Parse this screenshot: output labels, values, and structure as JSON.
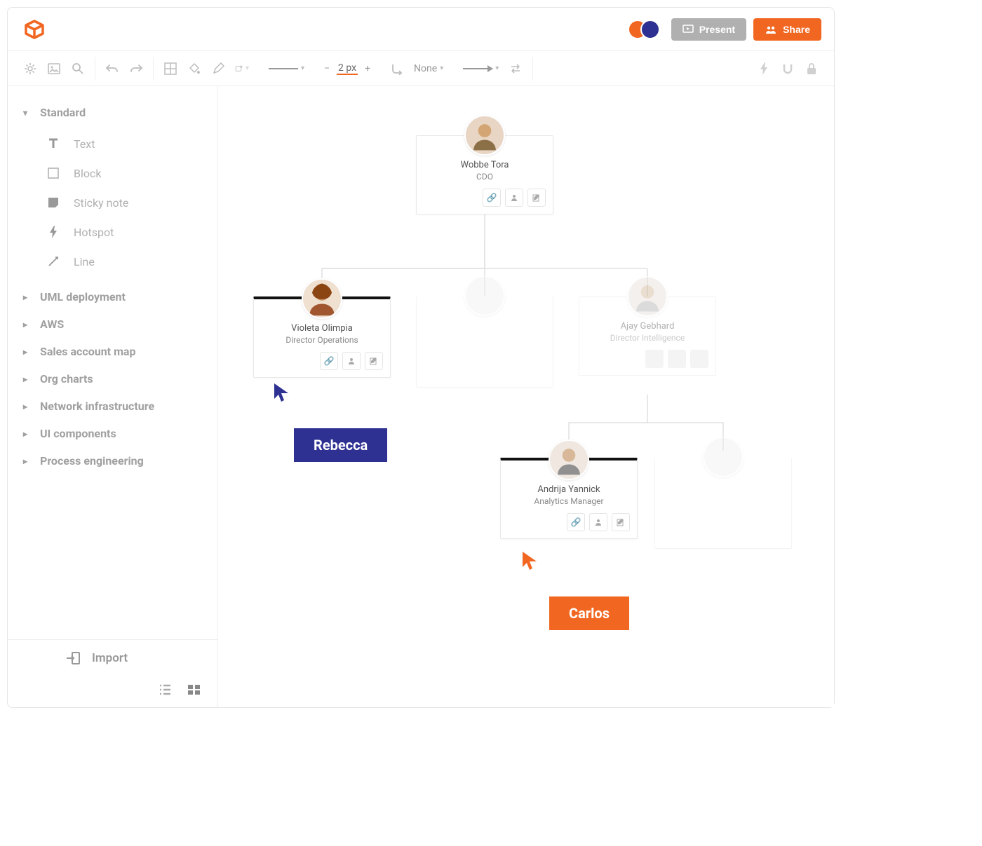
{
  "header": {
    "present_label": "Present",
    "share_label": "Share"
  },
  "toolbar": {
    "stroke_minus": "−",
    "stroke_value": "2 px",
    "stroke_plus": "+",
    "line_arc_label": "None"
  },
  "sidebar": {
    "categories": [
      {
        "label": "Standard",
        "expanded": true
      },
      {
        "label": "UML deployment",
        "expanded": false
      },
      {
        "label": "AWS",
        "expanded": false
      },
      {
        "label": "Sales account map",
        "expanded": false
      },
      {
        "label": "Org charts",
        "expanded": false
      },
      {
        "label": "Network infrastructure",
        "expanded": false
      },
      {
        "label": "UI components",
        "expanded": false
      },
      {
        "label": "Process engineering",
        "expanded": false
      }
    ],
    "standard_shapes": [
      {
        "label": "Text"
      },
      {
        "label": "Block"
      },
      {
        "label": "Sticky note"
      },
      {
        "label": "Hotspot"
      },
      {
        "label": "Line"
      }
    ],
    "import_label": "Import"
  },
  "canvas": {
    "nodes": {
      "cdo": {
        "name": "Wobbe Tora",
        "title": "CDO"
      },
      "ops": {
        "name": "Violeta Olimpia",
        "title": "Director Operations"
      },
      "intel": {
        "name": "Ajay Gebhard",
        "title": "Director Intelligence"
      },
      "analytics": {
        "name": "Andrija Yannick",
        "title": "Analytics Manager"
      }
    },
    "cursors": {
      "rebecca": {
        "label": "Rebecca",
        "color": "blue"
      },
      "carlos": {
        "label": "Carlos",
        "color": "orange"
      }
    }
  }
}
